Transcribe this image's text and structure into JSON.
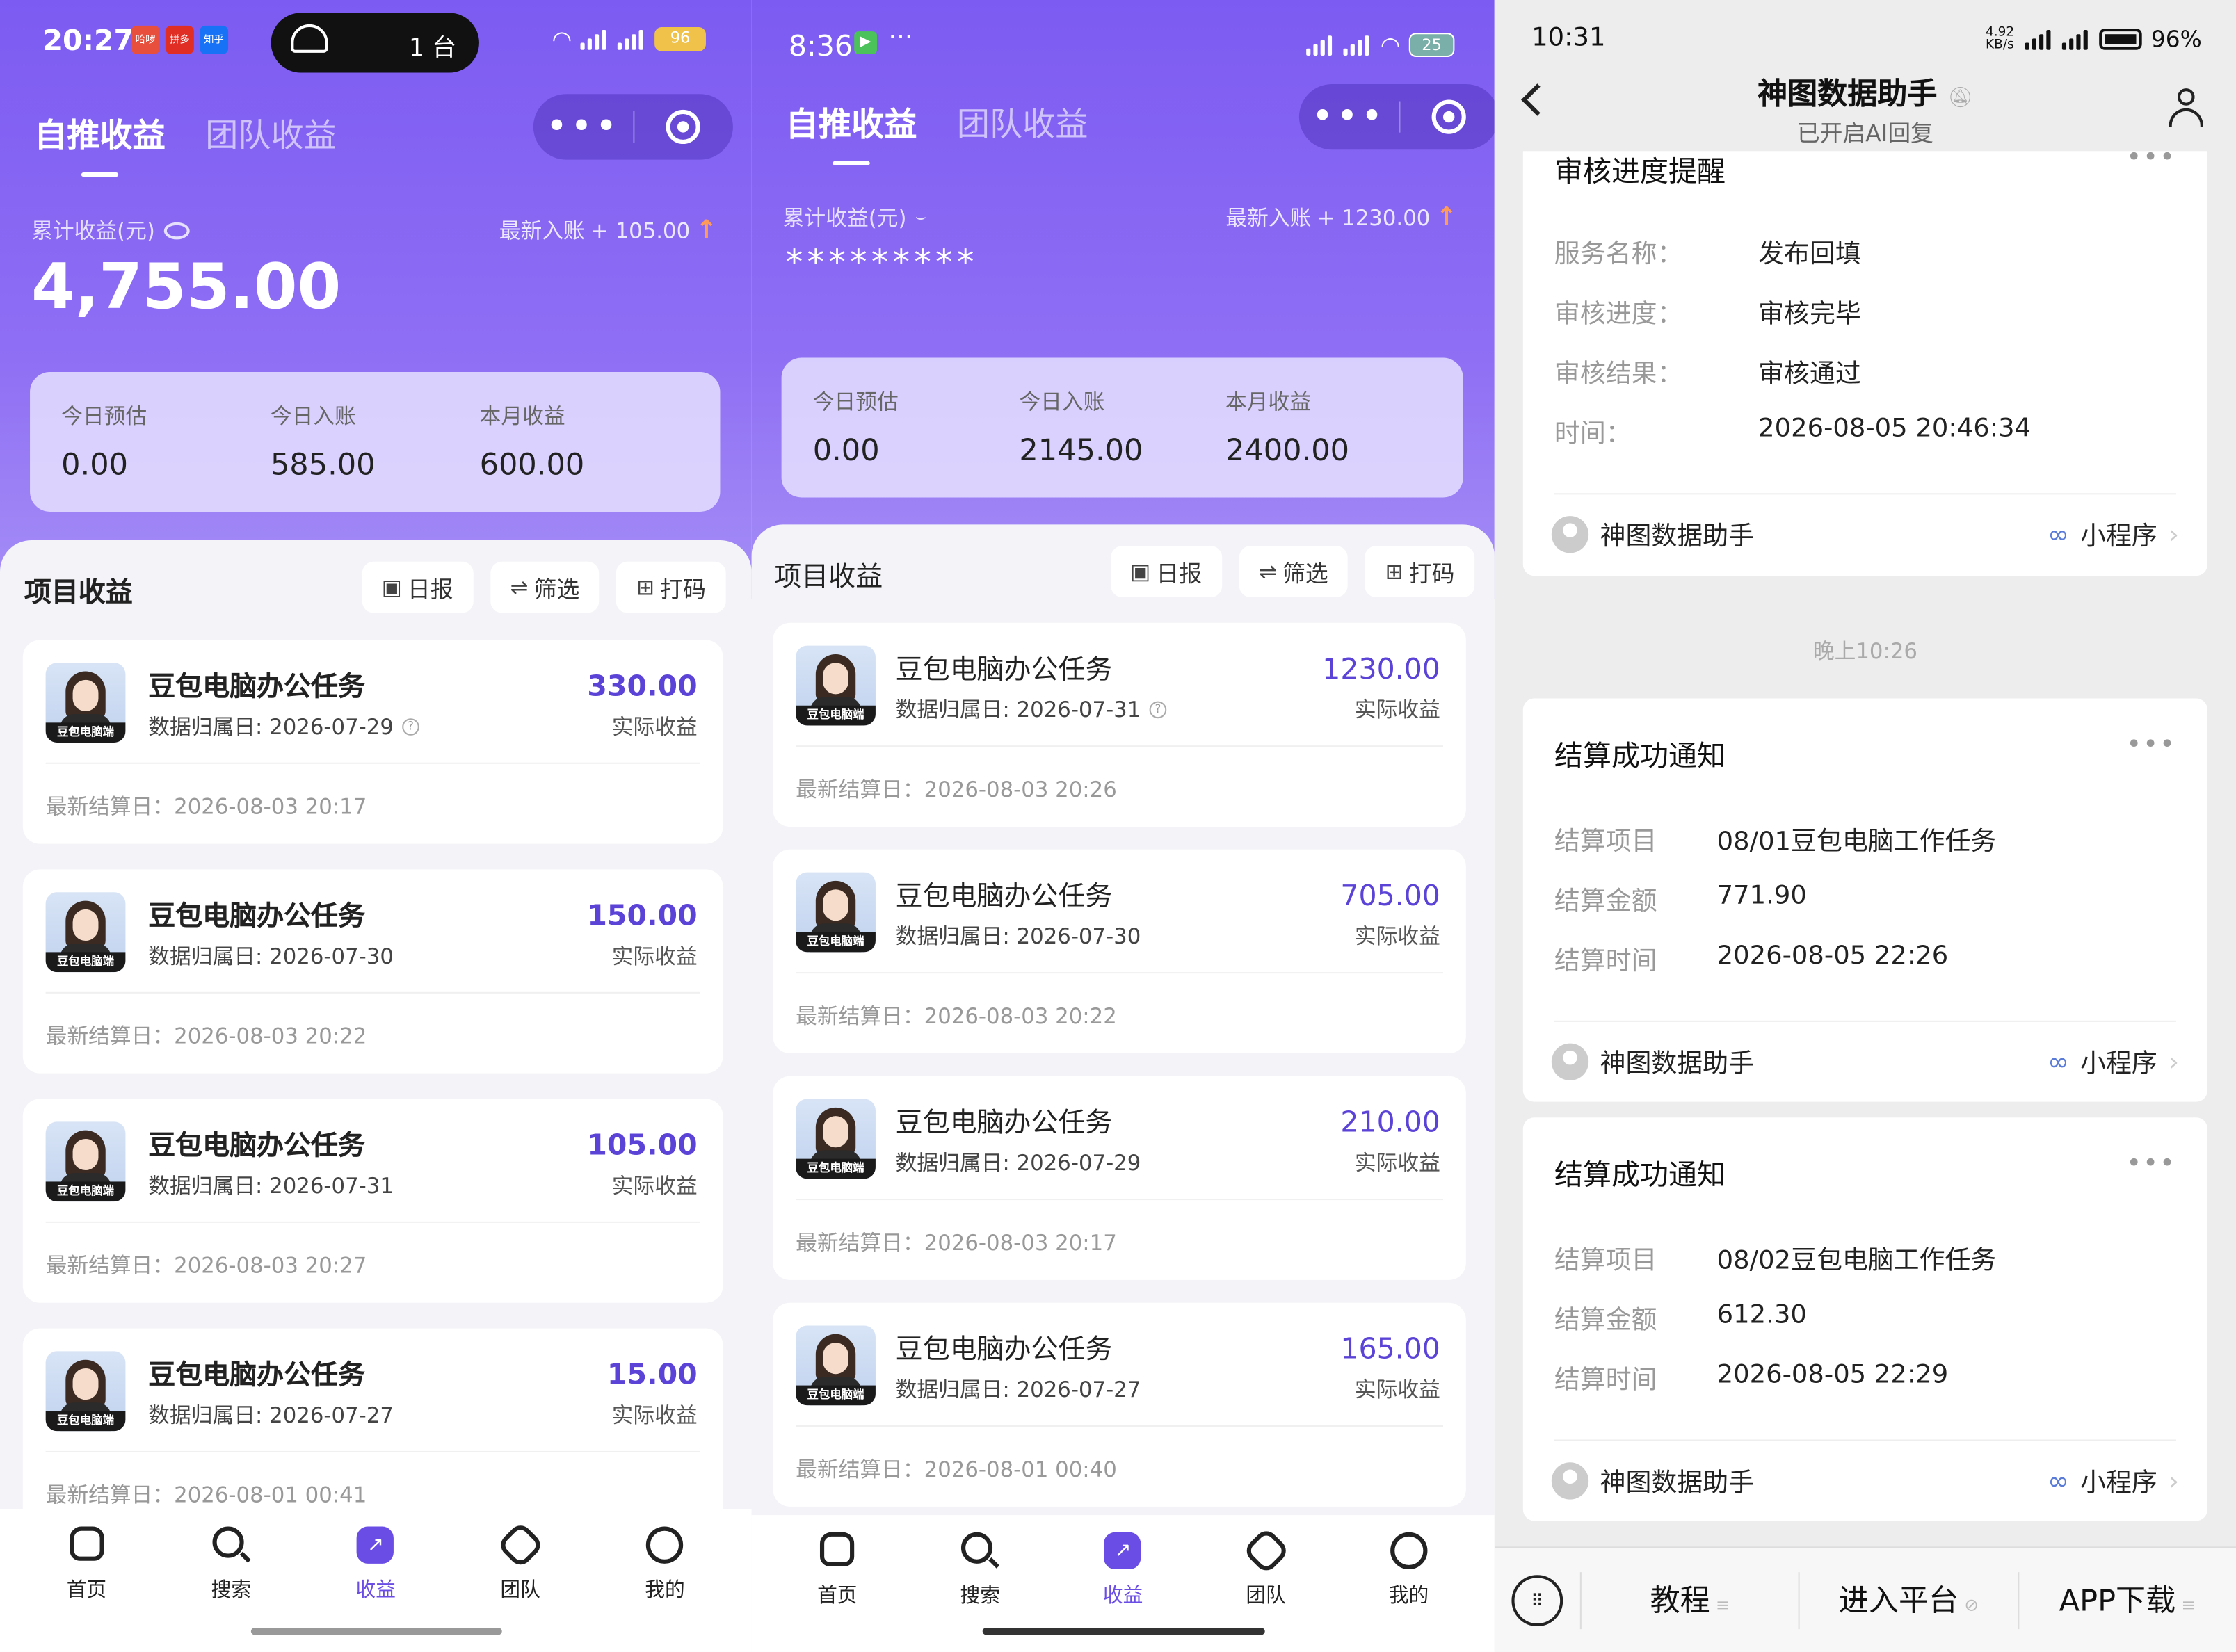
{
  "p1": {
    "status": {
      "time": "20:27",
      "pill_text": "1 台",
      "battery": "96",
      "app_badges": [
        "哈啰",
        "拼多多",
        "知乎"
      ]
    },
    "tabs": [
      "自推收益",
      "团队收益"
    ],
    "cum_label": "累计收益(元)",
    "latest_label": "最新入账",
    "latest_value": "+ 105.00",
    "total": "4,755.00",
    "stats": [
      {
        "label": "今日预估",
        "value": "0.00"
      },
      {
        "label": "今日入账",
        "value": "585.00"
      },
      {
        "label": "本月收益",
        "value": "600.00"
      }
    ],
    "section": "项目收益",
    "buttons": [
      "日报",
      "筛选",
      "打码"
    ],
    "cards": [
      {
        "name": "豆包电脑办公任务",
        "date": "数据归属日: 2026-07-29",
        "amount": "330.00",
        "amount_label": "实际收益",
        "settle": "最新结算日：2026-08-03 20:17"
      },
      {
        "name": "豆包电脑办公任务",
        "date": "数据归属日: 2026-07-30",
        "amount": "150.00",
        "amount_label": "实际收益",
        "settle": "最新结算日：2026-08-03 20:22"
      },
      {
        "name": "豆包电脑办公任务",
        "date": "数据归属日: 2026-07-31",
        "amount": "105.00",
        "amount_label": "实际收益",
        "settle": "最新结算日：2026-08-03 20:27"
      },
      {
        "name": "豆包电脑办公任务",
        "date": "数据归属日: 2026-07-27",
        "amount": "15.00",
        "amount_label": "实际收益",
        "settle": "最新结算日：2026-08-01 00:41"
      }
    ],
    "avatar_tag": "豆包电脑端",
    "nav": [
      "首页",
      "搜索",
      "收益",
      "团队",
      "我的"
    ]
  },
  "p2": {
    "status": {
      "time": "8:36",
      "battery": "25"
    },
    "tabs": [
      "自推收益",
      "团队收益"
    ],
    "cum_label": "累计收益(元)",
    "latest_label": "最新入账",
    "latest_value": "+ 1230.00",
    "total_masked": "*********",
    "stats": [
      {
        "label": "今日预估",
        "value": "0.00"
      },
      {
        "label": "今日入账",
        "value": "2145.00"
      },
      {
        "label": "本月收益",
        "value": "2400.00"
      }
    ],
    "section": "项目收益",
    "buttons": [
      "日报",
      "筛选",
      "打码"
    ],
    "cards": [
      {
        "name": "豆包电脑办公任务",
        "date": "数据归属日: 2026-07-31",
        "amount": "1230.00",
        "amount_label": "实际收益",
        "settle": "最新结算日：2026-08-03 20:26"
      },
      {
        "name": "豆包电脑办公任务",
        "date": "数据归属日: 2026-07-30",
        "amount": "705.00",
        "amount_label": "实际收益",
        "settle": "最新结算日：2026-08-03 20:22"
      },
      {
        "name": "豆包电脑办公任务",
        "date": "数据归属日: 2026-07-29",
        "amount": "210.00",
        "amount_label": "实际收益",
        "settle": "最新结算日：2026-08-03 20:17"
      },
      {
        "name": "豆包电脑办公任务",
        "date": "数据归属日: 2026-07-27",
        "amount": "165.00",
        "amount_label": "实际收益",
        "settle": "最新结算日：2026-08-01 00:40"
      }
    ],
    "avatar_tag": "豆包电脑端",
    "nav": [
      "首页",
      "搜索",
      "收益",
      "团队",
      "我的"
    ]
  },
  "p3": {
    "status": {
      "time": "10:31",
      "speed": "4.92 KB/s",
      "battery": "96%"
    },
    "title": "神图数据助手",
    "subtitle": "已开启AI回复",
    "review": {
      "title": "审核进度提醒",
      "rows": [
        {
          "k": "服务名称：",
          "v": "发布回填"
        },
        {
          "k": "审核进度：",
          "v": "审核完毕"
        },
        {
          "k": "审核结果：",
          "v": "审核通过"
        },
        {
          "k": "时间：",
          "v": "2026-08-05 20:46:34"
        }
      ]
    },
    "timestamp": "晚上10:26",
    "settle": [
      {
        "title": "结算成功通知",
        "rows": [
          {
            "k": "结算项目",
            "v": "08/01豆包电脑工作任务"
          },
          {
            "k": "结算金额",
            "v": "771.90"
          },
          {
            "k": "结算时间",
            "v": "2026-08-05 22:26"
          }
        ]
      },
      {
        "title": "结算成功通知",
        "rows": [
          {
            "k": "结算项目",
            "v": "08/02豆包电脑工作任务"
          },
          {
            "k": "结算金额",
            "v": "612.30"
          },
          {
            "k": "结算时间",
            "v": "2026-08-05 22:29"
          }
        ]
      }
    ],
    "sender": "神图数据助手",
    "mini_program": "小程序",
    "bottom_menu": [
      "教程",
      "进入平台",
      "APP下载"
    ]
  },
  "colors": {
    "purple": "#7c5bf2",
    "accent_amount": "#5a43d6",
    "nav_active": "#6a4de4"
  }
}
